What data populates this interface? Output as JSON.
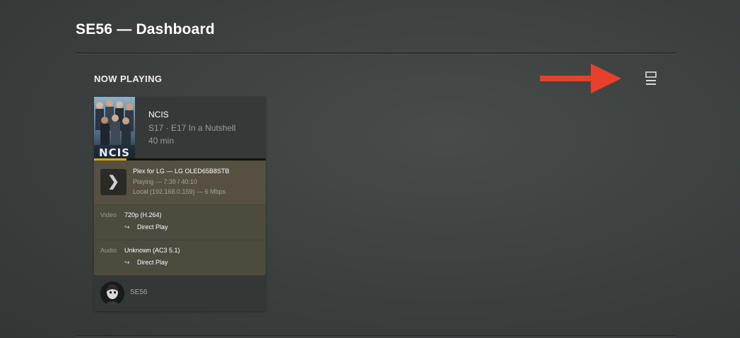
{
  "page": {
    "title": "SE56 — Dashboard"
  },
  "now_playing": {
    "heading": "NOW PLAYING",
    "layout_toggle_icon": "list-layout-icon",
    "annotation_arrow_color": "#e8402b",
    "session": {
      "poster_text": "NCIS",
      "title": "NCIS",
      "episode": "S17 · E17 In a Nutshell",
      "duration": "40 min",
      "progress_fraction": 0.19,
      "progress_color": "#e5a00d",
      "player": {
        "icon": "chevron-right-icon",
        "name": "Plex for LG  —  LG OLED65B8STB",
        "state": "Playing — 7:39 / 40:10",
        "network": "Local (192.168.0.159) — 6 Mbps"
      },
      "video": {
        "label": "Video",
        "value": "720p (H.264)",
        "decision": "Direct Play"
      },
      "audio": {
        "label": "Audio",
        "value": "Unknown (AC3 5.1)",
        "decision": "Direct Play"
      },
      "user": {
        "name": "SE56"
      }
    }
  }
}
